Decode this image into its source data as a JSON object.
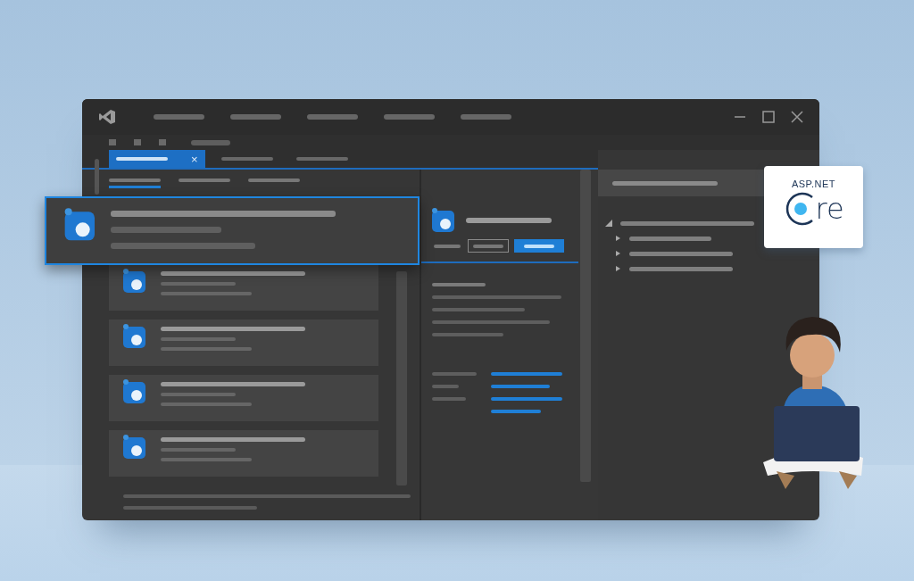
{
  "logo": {
    "caption": "ASP.NET",
    "wordmark": "re"
  },
  "tabs": [
    {
      "close": "×",
      "selected": true
    },
    {
      "selected": false
    },
    {
      "selected": false
    }
  ],
  "subtabs": [
    {
      "selected": true
    },
    {
      "selected": false
    },
    {
      "selected": false
    }
  ],
  "list": [
    {
      "selected": true
    },
    {
      "selected": false
    },
    {
      "selected": false
    },
    {
      "selected": false
    },
    {
      "selected": false
    }
  ],
  "detail_buttons": [
    {
      "kind": "plain"
    },
    {
      "kind": "outlined"
    },
    {
      "kind": "primary"
    }
  ],
  "tree": [
    {
      "expanded": true,
      "children": [
        {
          "expanded": false
        },
        {
          "expanded": false
        },
        {
          "expanded": false
        }
      ]
    }
  ]
}
